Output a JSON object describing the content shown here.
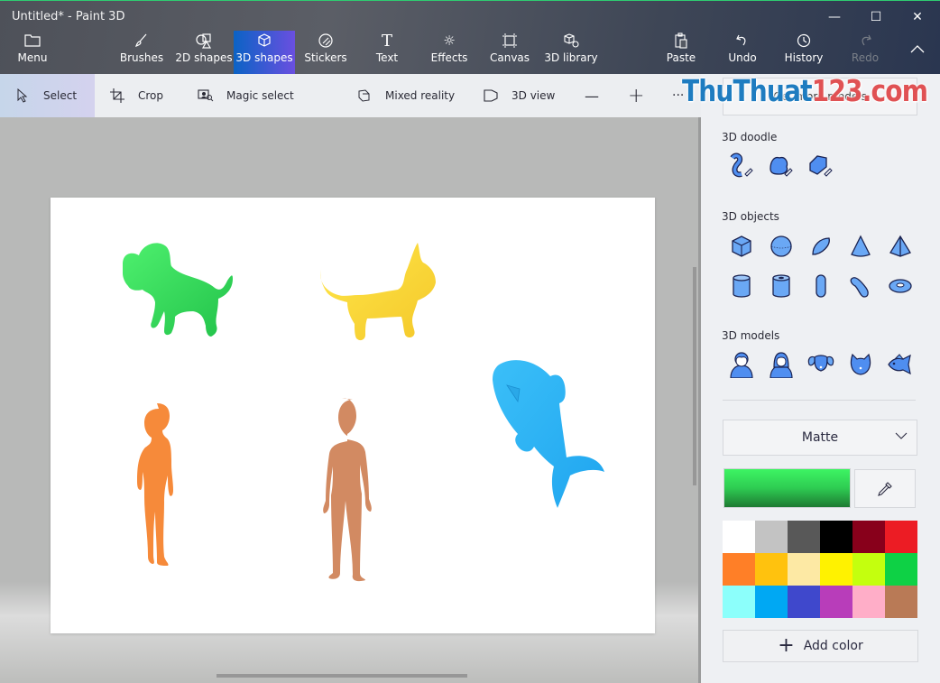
{
  "window": {
    "title": "Untitled* - Paint 3D",
    "controls": {
      "minimize": "—",
      "maximize": "☐",
      "close": "✕"
    }
  },
  "ribbon": {
    "menu": "Menu",
    "tabs": [
      {
        "label": "Brushes",
        "icon": "brush-icon"
      },
      {
        "label": "2D shapes",
        "icon": "2d-shapes-icon"
      },
      {
        "label": "3D shapes",
        "icon": "3d-cube-icon",
        "active": true
      },
      {
        "label": "Stickers",
        "icon": "sticker-icon"
      },
      {
        "label": "Text",
        "icon": "text-icon"
      },
      {
        "label": "Effects",
        "icon": "effects-sun-icon"
      },
      {
        "label": "Canvas",
        "icon": "canvas-icon"
      },
      {
        "label": "3D library",
        "icon": "3d-library-icon"
      }
    ],
    "actions": [
      {
        "label": "Paste",
        "icon": "paste-icon"
      },
      {
        "label": "Undo",
        "icon": "undo-icon"
      },
      {
        "label": "History",
        "icon": "history-icon"
      },
      {
        "label": "Redo",
        "icon": "redo-icon",
        "disabled": true
      }
    ],
    "collapse": "^"
  },
  "toolbar": {
    "select": "Select",
    "crop": "Crop",
    "magic_select": "Magic select",
    "mixed_reality": "Mixed reality",
    "view_3d": "3D view",
    "zoom_out": "—",
    "zoom_in": "+",
    "more": "···"
  },
  "canvas": {
    "objects": [
      "green dog",
      "yellow cat",
      "blue fish",
      "orange woman",
      "tan man"
    ]
  },
  "panel": {
    "more_button": "Get more models",
    "doodle_title": "3D doodle",
    "objects_title": "3D objects",
    "models_title": "3D models",
    "material": "Matte",
    "current_color": "#2ecc52",
    "add_color": "Add color",
    "palette": [
      "#ffffff",
      "#c3c3c3",
      "#585858",
      "#000000",
      "#88001b",
      "#ec1c24",
      "#ff7f27",
      "#ffc20e",
      "#fde9a4",
      "#fff200",
      "#c4ff0e",
      "#0ed145",
      "#8cfffb",
      "#00a8f3",
      "#3f48cc",
      "#b83dba",
      "#ffaec8",
      "#b97a56"
    ]
  },
  "watermark": {
    "part1": "ThuThuat",
    "part2": "123.com"
  }
}
